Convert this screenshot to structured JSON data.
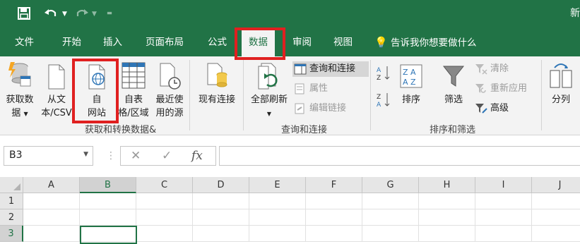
{
  "title_fragment": "新",
  "quick_access": {
    "save_icon": "save-icon",
    "undo_icon": "undo-icon",
    "redo_icon": "redo-icon",
    "customize_icon": "customize-icon"
  },
  "tabs": [
    "文件",
    "开始",
    "插入",
    "页面布局",
    "公式",
    "数据",
    "审阅",
    "视图"
  ],
  "active_tab": "数据",
  "tell_me": "告诉我你想要做什么",
  "ribbon": {
    "get_transform": {
      "get_data": [
        "获取数",
        "据"
      ],
      "from_text": [
        "从文",
        "本/CSV"
      ],
      "from_web": [
        "自",
        "网站"
      ],
      "from_table": [
        "自表",
        "格/区域"
      ],
      "recent_sources": [
        "最近使",
        "用的源"
      ],
      "existing_connections": "现有连接",
      "group_label": "获取和转换数据&"
    },
    "queries": {
      "refresh_all": "全部刷新",
      "queries_connections": "查询和连接",
      "properties": "属性",
      "edit_links": "编辑链接",
      "group_label": "查询和连接"
    },
    "sort_filter": {
      "sort": "排序",
      "filter": "筛选",
      "clear": "清除",
      "reapply": "重新应用",
      "advanced": "高级",
      "group_label": "排序和筛选"
    },
    "split": "分列"
  },
  "formula_bar": {
    "name_box": "B3",
    "fx": "fx"
  },
  "columns": [
    "A",
    "B",
    "C",
    "D",
    "E",
    "F",
    "G",
    "H",
    "I",
    "J"
  ],
  "rows": [
    "1",
    "2",
    "3"
  ],
  "selected_cell": "B3",
  "colors": {
    "excel_green": "#217346",
    "highlight_red": "#e02020"
  }
}
